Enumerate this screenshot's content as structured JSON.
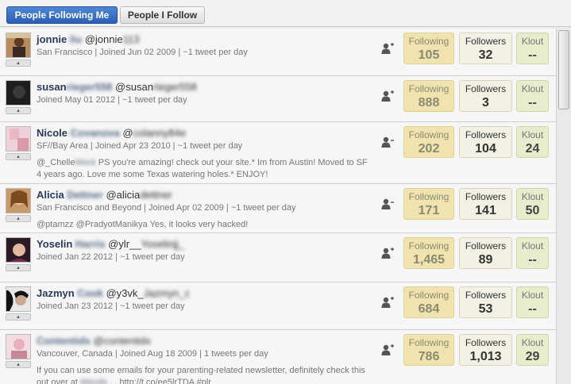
{
  "tabs": [
    {
      "label": "People Following Me",
      "active": true
    },
    {
      "label": "People I Follow",
      "active": false
    }
  ],
  "stat_labels": {
    "following": "Following",
    "followers": "Followers",
    "klout": "Klout"
  },
  "avatar_toggle_glyph": "▲",
  "users": [
    {
      "name": "jonnie",
      "name_blurred": "liu",
      "handle": "@jonnie",
      "handle_blurred": "113",
      "meta": "San Francisco | Joined Jun 02 2009 | ~1 tweet per day",
      "tweet": "",
      "tweet_blurred": "",
      "tweet_rest": "",
      "tweet_line2": "",
      "following": "105",
      "followers": "32",
      "klout": "--"
    },
    {
      "name": "susan",
      "name_blurred": "rieger558",
      "handle": "@susan",
      "handle_blurred": "rieger558",
      "meta": "Joined May 01 2012 | ~1 tweet per day",
      "tweet": "",
      "tweet_blurred": "",
      "tweet_rest": "",
      "tweet_line2": "",
      "following": "888",
      "followers": "3",
      "klout": "--"
    },
    {
      "name": "Nicole",
      "name_blurred": "Covanova",
      "handle": "@",
      "handle_blurred": "colanny84e",
      "meta": "SF//Bay Area | Joined Apr 23 2010 | ~1 tweet per day",
      "tweet": "@_Chelle",
      "tweet_blurred": "Mock",
      "tweet_rest": " PS you're amazing! check out your site.* Im from Austin! Moved to SF",
      "tweet_line2": "4 years ago. Love me some Texas watering holes.* ENJOY!",
      "following": "202",
      "followers": "104",
      "klout": "24"
    },
    {
      "name": "Alicia",
      "name_blurred": "Dettner",
      "handle": "@alicia",
      "handle_blurred": "dettner",
      "meta": "San Francisco and Beyond | Joined Apr 02 2009 | ~1 tweet per day",
      "tweet": "@ptamzz @PradyotManikya Yes, it looks very hacked!",
      "tweet_blurred": "",
      "tweet_rest": "",
      "tweet_line2": "",
      "following": "171",
      "followers": "141",
      "klout": "50"
    },
    {
      "name": "Yoselin",
      "name_blurred": "Harris",
      "handle": "@ylr__",
      "handle_blurred": "Yoselinjj_",
      "meta": "Joined Jan 22 2012 | ~1 tweet per day",
      "tweet": "",
      "tweet_blurred": "",
      "tweet_rest": "",
      "tweet_line2": "",
      "following": "1,465",
      "followers": "89",
      "klout": "--"
    },
    {
      "name": "Jazmyn",
      "name_blurred": "Cook",
      "handle": "@y3vk_",
      "handle_blurred": "Jazmyn_c",
      "meta": "Joined Jan 23 2012 | ~1 tweet per day",
      "tweet": "",
      "tweet_blurred": "",
      "tweet_rest": "",
      "tweet_line2": "",
      "following": "684",
      "followers": "53",
      "klout": "--"
    },
    {
      "name": "",
      "name_blurred": "Contentidx",
      "handle": "",
      "handle_blurred": "@contentidx",
      "meta": "Vancouver, Canada | Joined Aug 18 2009 | 1 tweets per day",
      "tweet": "If you can use some emails for your parenting-related newsletter, definitely check this",
      "tweet_blurred": "",
      "tweet_rest": "",
      "tweet_line2": "out  over at ",
      "tweet_line2_blurred": "Wendy",
      "tweet_line2_rest": " ... http://t.co/ee5lrTDA #plr",
      "following": "786",
      "followers": "1,013",
      "klout": "29"
    }
  ]
}
